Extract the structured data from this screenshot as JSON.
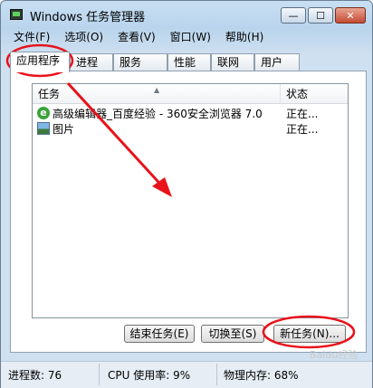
{
  "window": {
    "title": "Windows 任务管理器",
    "min_glyph": "—",
    "max_glyph": "☐",
    "close_glyph": "✕"
  },
  "menu": [
    "文件(F)",
    "选项(O)",
    "查看(V)",
    "窗口(W)",
    "帮助(H)"
  ],
  "tabs": [
    "应用程序",
    "进程",
    "服务",
    "性能",
    "联网",
    "用户"
  ],
  "active_tab": "应用程序",
  "list": {
    "columns": {
      "task": "任务",
      "status": "状态"
    },
    "rows": [
      {
        "icon": "ie-browser-icon",
        "name": "高级编辑器_百度经验 - 360安全浏览器 7.0",
        "status": "正在..."
      },
      {
        "icon": "picture-icon",
        "name": "图片",
        "status": "正在..."
      }
    ]
  },
  "buttons": {
    "end_task": "结束任务(E)",
    "switch_to": "切换至(S)",
    "new_task": "新任务(N)..."
  },
  "status": {
    "processes": "进程数: 76",
    "cpu": "CPU 使用率: 9%",
    "memory": "物理内存: 68%"
  },
  "annotation": {
    "color": "#e8121a"
  },
  "watermark": "Baidu经验"
}
